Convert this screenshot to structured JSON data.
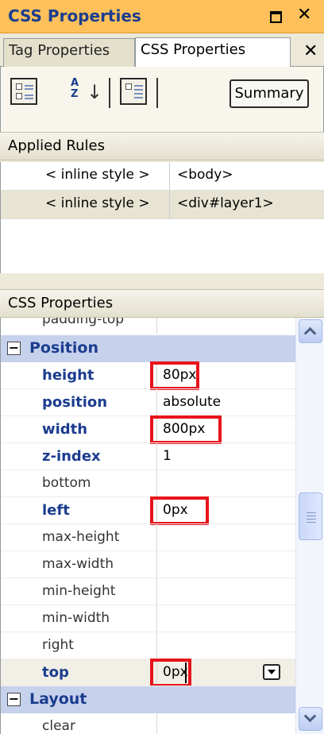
{
  "panel": {
    "title": "CSS Properties"
  },
  "tabs": [
    {
      "label": "Tag Properties",
      "active": false
    },
    {
      "label": "CSS Properties",
      "active": true
    }
  ],
  "toolbar": {
    "buttons": [
      {
        "name": "show-categorized-icon",
        "pressed": true
      },
      {
        "name": "sort-alphabetically-icon",
        "pressed": false
      },
      {
        "name": "show-set-properties-icon",
        "pressed": true
      }
    ],
    "summary_label": "Summary"
  },
  "applied_rules": {
    "header": "Applied Rules",
    "rows": [
      {
        "rule": "< inline style >",
        "element": "<body>",
        "selected": false
      },
      {
        "rule": "< inline style >",
        "element": "<div#layer1>",
        "selected": true
      }
    ]
  },
  "css_properties": {
    "header": "CSS Properties",
    "partial_row": "padding-top",
    "groups": [
      {
        "name": "Position",
        "expanded": true,
        "properties": [
          {
            "name": "height",
            "value": "80px",
            "set": true,
            "highlighted": true
          },
          {
            "name": "position",
            "value": "absolute",
            "set": true,
            "highlighted": false
          },
          {
            "name": "width",
            "value": "800px",
            "set": true,
            "highlighted": true
          },
          {
            "name": "z-index",
            "value": "1",
            "set": true,
            "highlighted": false
          },
          {
            "name": "bottom",
            "value": "",
            "set": false,
            "highlighted": false
          },
          {
            "name": "left",
            "value": "0px",
            "set": true,
            "highlighted": true
          },
          {
            "name": "max-height",
            "value": "",
            "set": false,
            "highlighted": false
          },
          {
            "name": "max-width",
            "value": "",
            "set": false,
            "highlighted": false
          },
          {
            "name": "min-height",
            "value": "",
            "set": false,
            "highlighted": false
          },
          {
            "name": "min-width",
            "value": "",
            "set": false,
            "highlighted": false
          },
          {
            "name": "right",
            "value": "",
            "set": false,
            "highlighted": false
          },
          {
            "name": "top",
            "value": "0px",
            "set": true,
            "highlighted": true,
            "editing": true
          }
        ]
      },
      {
        "name": "Layout",
        "expanded": true,
        "properties": [
          {
            "name": "clear",
            "value": ""
          }
        ]
      }
    ]
  },
  "colors": {
    "title_bar": "#fdc05a",
    "group_row": "#c6d1ec",
    "set_property_text": "#1b3d8f",
    "highlight_box": "#e8141b"
  }
}
